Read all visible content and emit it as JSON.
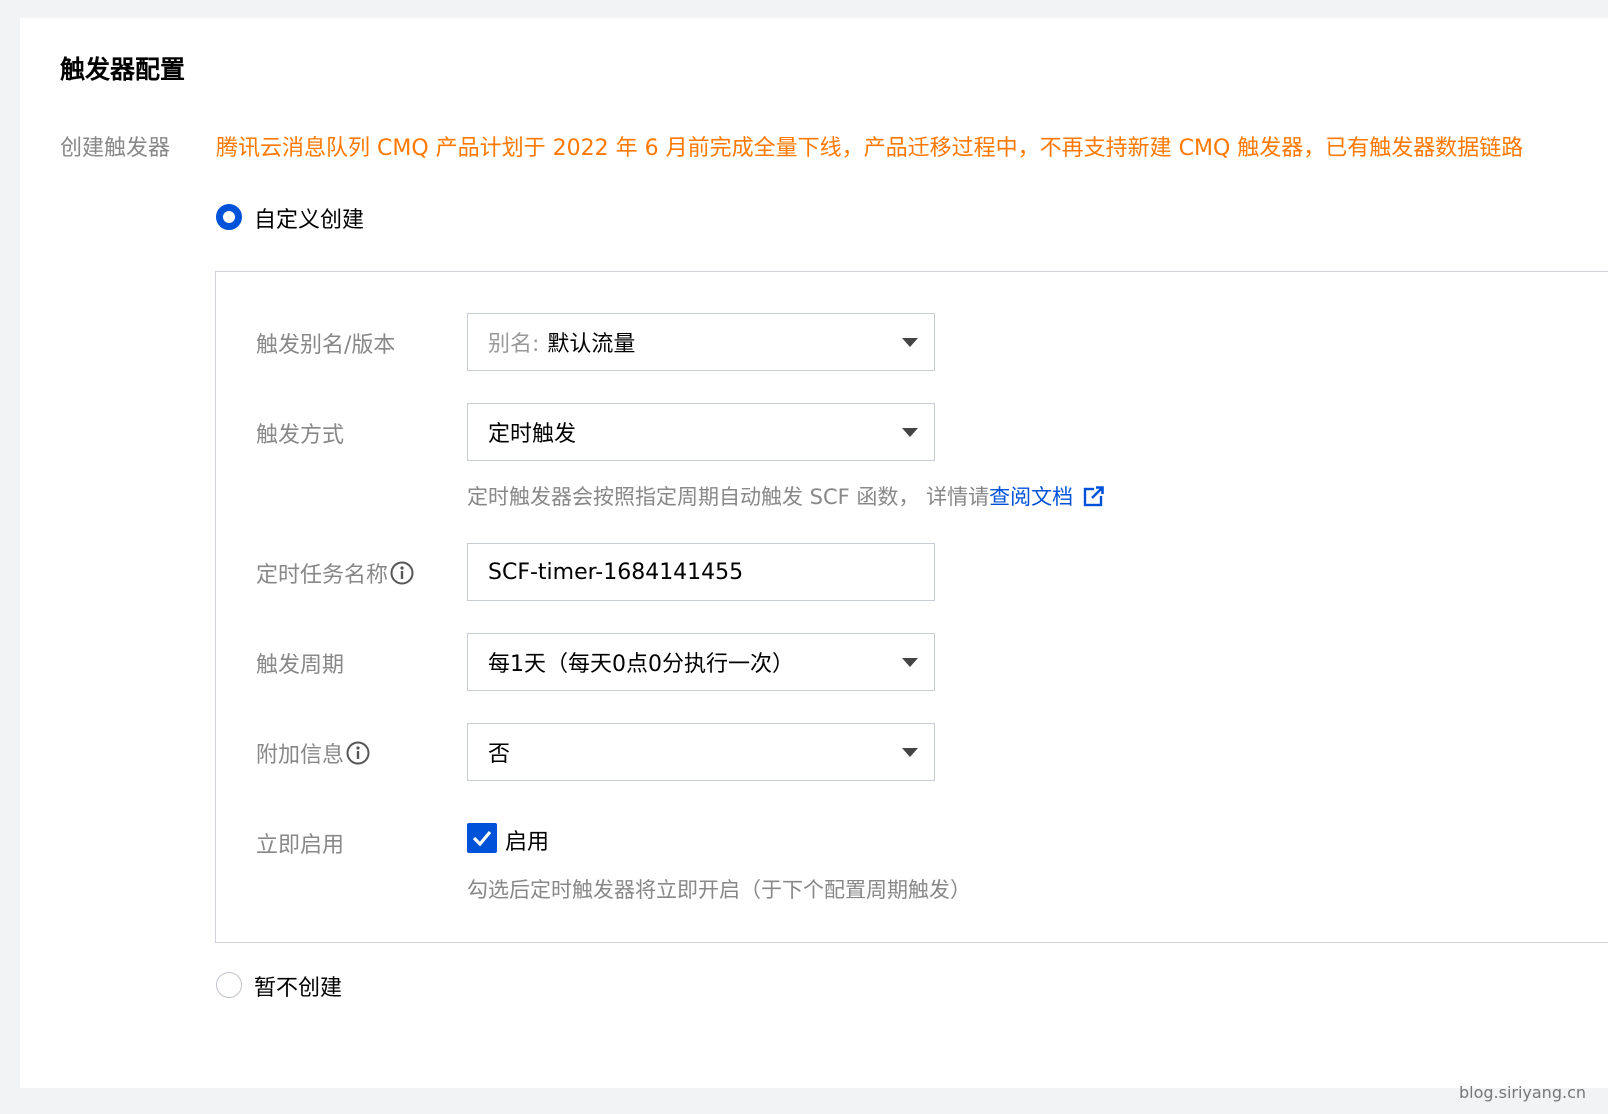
{
  "section": {
    "title": "触发器配置",
    "create_label": "创建触发器",
    "notice": "腾讯云消息队列 CMQ 产品计划于 2022 年 6 月前完成全量下线，产品迁移过程中，不再支持新建 CMQ 触发器，已有触发器数据链路"
  },
  "options": {
    "custom": "自定义创建",
    "none": "暂不创建",
    "selected": "custom"
  },
  "form": {
    "alias": {
      "label": "触发别名/版本",
      "prefix": "别名:",
      "value": "默认流量"
    },
    "method": {
      "label": "触发方式",
      "value": "定时触发",
      "hint": "定时触发器会按照指定周期自动触发 SCF 函数， 详情请",
      "hint_link": "查阅文档"
    },
    "task_name": {
      "label": "定时任务名称",
      "value": "SCF-timer-1684141455"
    },
    "period": {
      "label": "触发周期",
      "value": "每1天（每天0点0分执行一次）"
    },
    "extra": {
      "label": "附加信息",
      "value": "否"
    },
    "enable": {
      "label": "立即启用",
      "checkbox_label": "启用",
      "checked": true,
      "hint": "勾选后定时触发器将立即开启（于下个配置周期触发）"
    }
  },
  "colors": {
    "primary": "#0052d9",
    "warning": "#ff7800"
  },
  "watermark": "blog.siriyang.cn"
}
